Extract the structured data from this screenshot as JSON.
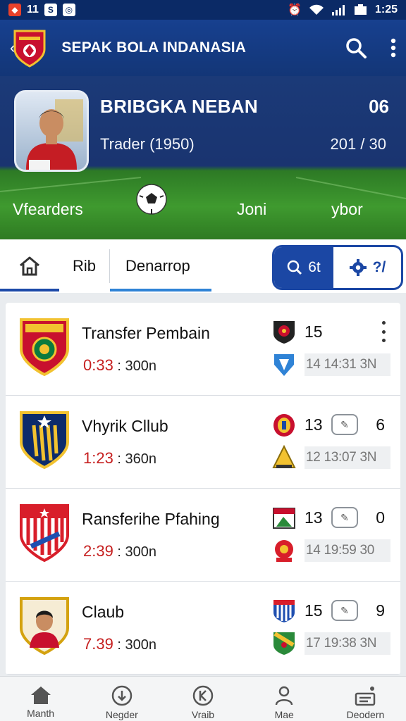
{
  "status_bar": {
    "time": "1:25",
    "left_number": "11"
  },
  "app_bar": {
    "title": "SEPAK BOLA INDANASIA"
  },
  "hero": {
    "player_name": "BRIBGKA NEBAN",
    "player_subtitle": "Trader (1950)",
    "top_number": "06",
    "bottom_number": "201 / 30",
    "labels": [
      "Vfearders",
      "Joni",
      "ybor"
    ]
  },
  "tabs": {
    "tab1": "Rib",
    "tab2": "Denarrop",
    "seg1": "6t",
    "seg2": "?/"
  },
  "list": [
    {
      "title": "Transfer Pembain",
      "time": "0:33",
      "detail": ": 300n",
      "score": "15",
      "right": "",
      "stats": "14 14:31 3N",
      "crest_colors": [
        "#c8102e",
        "#f2c230",
        "#0b7a3e"
      ]
    },
    {
      "title": "Vhyrik Cllub",
      "time": "1:23",
      "detail": ": 360n",
      "score": "13",
      "right": "6",
      "stats": "12 13:07 3N",
      "crest_colors": [
        "#0d2b6b",
        "#f2c230",
        "#ffffff"
      ]
    },
    {
      "title": "Ransferihe Pfahing",
      "time": "2:39",
      "detail": ": 300n",
      "score": "13",
      "right": "0",
      "stats": "14 19:59 30",
      "crest_colors": [
        "#d81e2a",
        "#ffffff",
        "#1f4fb0"
      ]
    },
    {
      "title": "Claub",
      "time": "7.39",
      "detail": ": 300n",
      "score": "15",
      "right": "9",
      "stats": "17 19:38 3N",
      "crest_colors": [
        "#f3c31b",
        "#c8102e",
        "#ffffff"
      ]
    }
  ],
  "bottom_nav": [
    "Manth",
    "Negder",
    "Vraib",
    "Mae",
    "Deodern"
  ]
}
